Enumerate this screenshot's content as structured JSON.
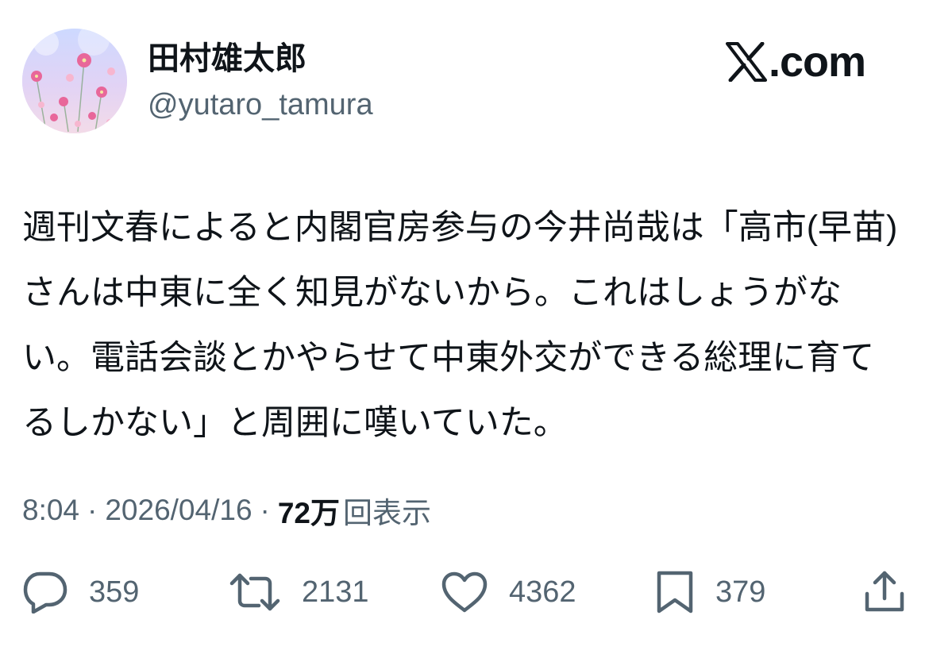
{
  "author": {
    "display_name": "田村雄太郎",
    "handle": "@yutaro_tamura",
    "avatar": "cosmos-flower-photo"
  },
  "brand": {
    "icon": "x-logo-icon",
    "text": ".com"
  },
  "tweet": {
    "text": "週刊文春によると内閣官房参与の今井尚哉は「高市(早苗)さんは中東に全く知見がないから。これはしょうがない。電話会談とかやらせて中東外交ができる総理に育てるしかない」と周囲に嘆いていた。"
  },
  "meta": {
    "time": "8:04",
    "separator": "·",
    "date": "2026/04/16",
    "views_count": "72万",
    "views_label": "回表示"
  },
  "actions": {
    "reply": {
      "icon": "reply-icon",
      "count": "359"
    },
    "retweet": {
      "icon": "retweet-icon",
      "count": "2131"
    },
    "like": {
      "icon": "heart-icon",
      "count": "4362"
    },
    "bookmark": {
      "icon": "bookmark-icon",
      "count": "379"
    },
    "share": {
      "icon": "share-icon"
    }
  },
  "colors": {
    "text_primary": "#0f1419",
    "text_secondary": "#536471",
    "background": "#ffffff"
  }
}
